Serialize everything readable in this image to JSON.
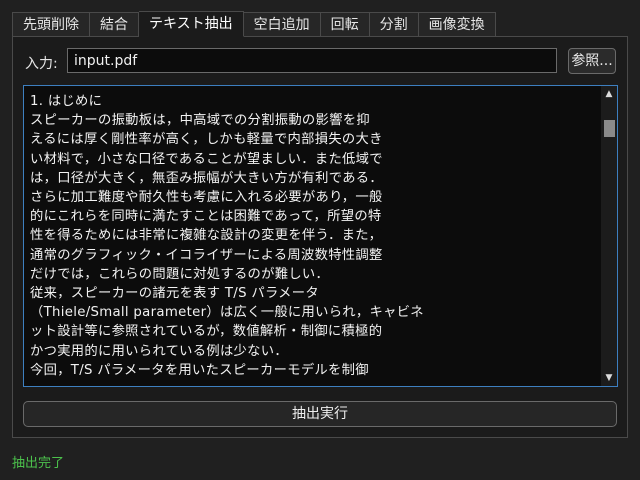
{
  "tabs": [
    {
      "label": "先頭削除",
      "active": false
    },
    {
      "label": "結合",
      "active": false
    },
    {
      "label": "テキスト抽出",
      "active": true
    },
    {
      "label": "空白追加",
      "active": false
    },
    {
      "label": "回転",
      "active": false
    },
    {
      "label": "分割",
      "active": false
    },
    {
      "label": "画像変換",
      "active": false
    }
  ],
  "input": {
    "label": "入力:",
    "value": "input.pdf",
    "browse_label": "参照..."
  },
  "extracted_text": "1. はじめに\nスピーカーの振動板は，中高域での分割振動の影響を抑\nえるには厚く剛性率が高く，しかも軽量で内部損失の大き\nい材料で，小さな口径であることが望ましい．また低域で\nは，口径が大きく，無歪み振幅が大きい方が有利である．\nさらに加工難度や耐久性も考慮に入れる必要があり，一般\n的にこれらを同時に満たすことは困難であって，所望の特\n性を得るためには非常に複雑な設計の変更を伴う．また，\n通常のグラフィック・イコライザーによる周波数特性調整\nだけでは，これらの問題に対処するのが難しい．\n従来，スピーカーの諸元を表す T/S パラメータ\n（Thiele/Small parameter）は広く一般に用いられ，キャビネ\nット設計等に参照されているが，数値解析・制御に積極的\nかつ実用的に用いられている例は少ない．\n今回，T/S パラメータを用いたスピーカーモデルを制御\n対象とした状態フィードバック制御を行い，通常のグラフ",
  "run_button_label": "抽出実行",
  "status_text": "抽出完了",
  "colors": {
    "status": "#4cc14c",
    "focus_border": "#3d7fc0"
  }
}
